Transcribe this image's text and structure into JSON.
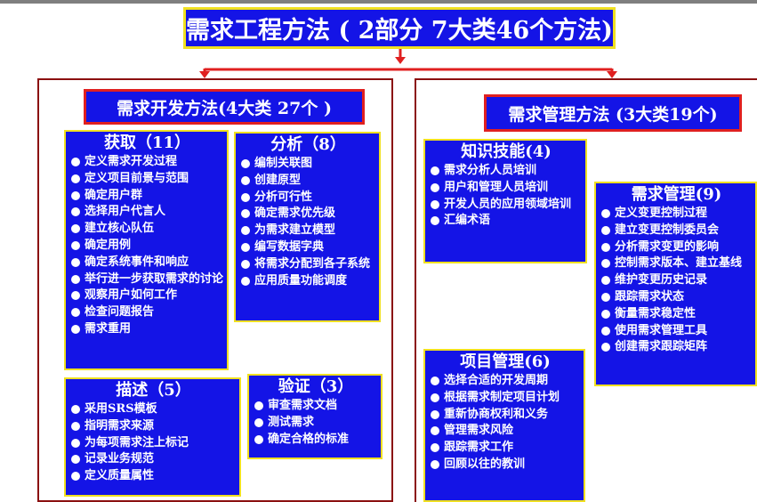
{
  "title": "需求工程方法 ( 2部分 7大类46个方法)",
  "development": {
    "heading": "需求开发方法(4大类 27个 )",
    "cards": {
      "acquire": {
        "title": "获取（11）",
        "items": [
          "定义需求开发过程",
          "定义项目前景与范围",
          "确定用户群",
          "选择用户代言人",
          "建立核心队伍",
          "确定用例",
          "确定系统事件和响应",
          "举行进一步获取需求的讨论",
          "观察用户如何工作",
          "检查问题报告",
          "需求重用"
        ]
      },
      "analyze": {
        "title": "分析（8）",
        "items": [
          "编制关联图",
          "创建原型",
          "分析可行性",
          "确定需求优先级",
          "为需求建立模型",
          "编写数据字典",
          "将需求分配到各子系统",
          "应用质量功能调度"
        ]
      },
      "describe": {
        "title": "描述（5）",
        "items": [
          "采用SRS模板",
          "指明需求来源",
          "为每项需求注上标记",
          "记录业务规范",
          "定义质量属性"
        ]
      },
      "verify": {
        "title": "验证（3）",
        "items": [
          "审查需求文档",
          "测试需求",
          "确定合格的标准"
        ]
      }
    }
  },
  "management": {
    "heading": "需求管理方法 (3大类19个)",
    "cards": {
      "knowledge": {
        "title": "知识技能(4)",
        "items": [
          "需求分析人员培训",
          "用户和管理人员培训",
          "开发人员的应用领域培训",
          "汇编术语"
        ]
      },
      "reqmgmt": {
        "title": "需求管理(9)",
        "items": [
          "定义变更控制过程",
          "建立变更控制委员会",
          "分析需求变更的影响",
          "控制需求版本、建立基线",
          "维护变更历史记录",
          "跟踪需求状态",
          "衡量需求稳定性",
          "使用需求管理工具",
          "创建需求跟踪矩阵"
        ]
      },
      "project": {
        "title": "项目管理(6)",
        "items": [
          "选择合适的开发周期",
          "根据需求制定项目计划",
          "重新协商权利和义务",
          "管理需求风险",
          "跟踪需求工作",
          "回顾以往的教训"
        ]
      }
    }
  },
  "colors": {
    "box_fill": "#1414e6",
    "box_border": "#f0e020",
    "panel_border": "#8b1010",
    "arrow": "#e02020"
  }
}
